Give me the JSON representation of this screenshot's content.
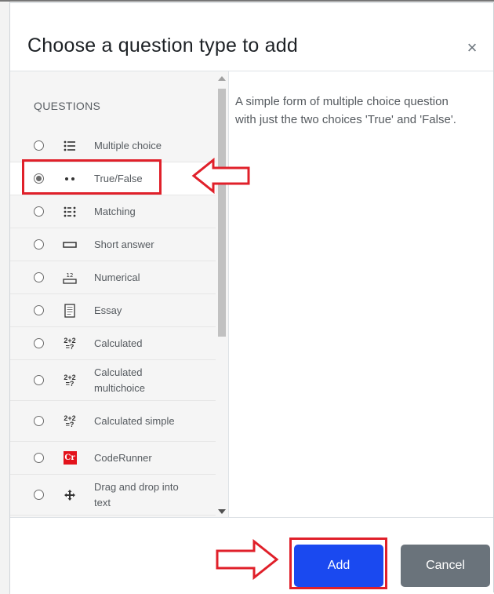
{
  "dialog": {
    "title": "Choose a question type to add",
    "close_symbol": "×"
  },
  "options_panel": {
    "section_label": "QUESTIONS",
    "items": [
      {
        "label": "Multiple choice",
        "icon": "multiple-choice-icon",
        "selected": false
      },
      {
        "label": "True/False",
        "icon": "true-false-icon",
        "selected": true
      },
      {
        "label": "Matching",
        "icon": "matching-icon",
        "selected": false
      },
      {
        "label": "Short answer",
        "icon": "short-answer-icon",
        "selected": false
      },
      {
        "label": "Numerical",
        "icon": "numerical-icon",
        "selected": false
      },
      {
        "label": "Essay",
        "icon": "essay-icon",
        "selected": false
      },
      {
        "label": "Calculated",
        "icon": "calculated-icon",
        "selected": false
      },
      {
        "label": "Calculated multichoice",
        "icon": "calculated-multichoice-icon",
        "selected": false
      },
      {
        "label": "Calculated simple",
        "icon": "calculated-simple-icon",
        "selected": false
      },
      {
        "label": "CodeRunner",
        "icon": "coderunner-icon",
        "icon_text": "Cr",
        "selected": false
      },
      {
        "label": "Drag and drop into text",
        "icon": "drag-drop-icon",
        "selected": false
      }
    ],
    "numerical_icon_text": "12",
    "calc_icon_top": "2+2",
    "calc_icon_bottom": "=?"
  },
  "description": "A simple form of multiple choice question with just the two choices 'True' and 'False'.",
  "footer": {
    "add_label": "Add",
    "cancel_label": "Cancel"
  },
  "colors": {
    "primary": "#1a49f0",
    "secondary": "#6a737b",
    "annotation": "#e0202a",
    "coderunner": "#e3121b"
  }
}
